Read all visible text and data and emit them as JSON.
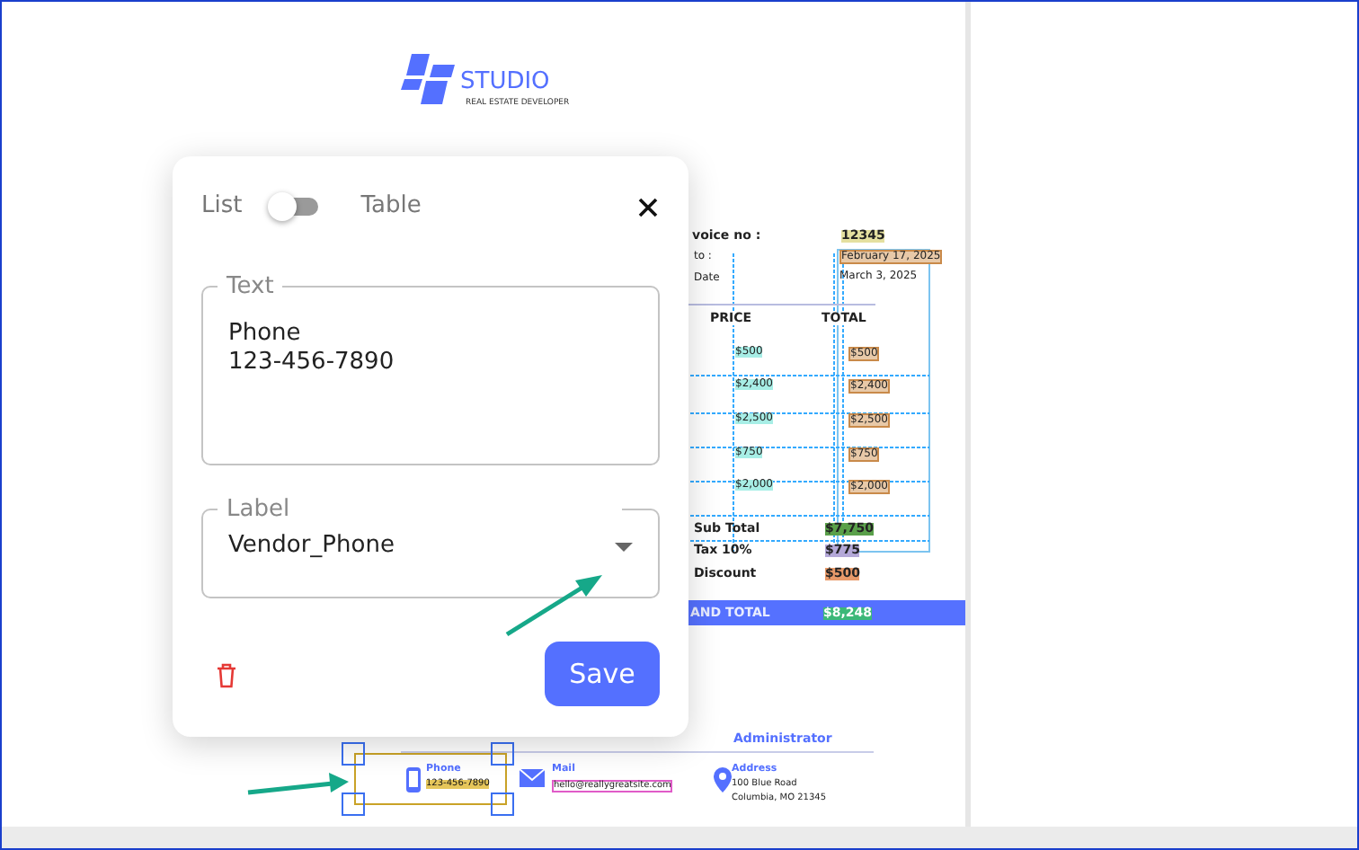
{
  "document": {
    "logo_title": "STUDIO",
    "logo_subtitle": "REAL ESTATE DEVELOPER",
    "invoice_label": "voice no :",
    "invoice_no": "12345",
    "to_label": "to :",
    "issue_date": "February 17, 2025",
    "date_label": "Date",
    "due_date": "March 3, 2025",
    "columns": [
      "PRICE",
      "TOTAL"
    ],
    "rows": [
      {
        "price": "$500",
        "total": "$500"
      },
      {
        "price": "$2,400",
        "total": "$2,400"
      },
      {
        "price": "$2,500",
        "total": "$2,500"
      },
      {
        "price": "$750",
        "total": "$750"
      },
      {
        "price": "$2,000",
        "total": "$2,000"
      }
    ],
    "summary": [
      {
        "label": "Sub Total",
        "value": "$7,750"
      },
      {
        "label": "Tax 10%",
        "value": "$775"
      },
      {
        "label": "Discount",
        "value": "$500"
      }
    ],
    "grand_total_label": "AND TOTAL",
    "grand_total": "$8,248",
    "footer": {
      "role": "Administrator",
      "contacts": [
        {
          "kind": "phone",
          "label": "Phone",
          "lines": [
            "123-456-7890"
          ],
          "selected": true
        },
        {
          "kind": "mail",
          "label": "Mail",
          "lines": [
            "hello@reallygreatsite.com"
          ],
          "selected": false
        },
        {
          "kind": "address",
          "label": "Address",
          "lines": [
            "100 Blue Road",
            "Columbia, MO 21345"
          ],
          "selected": false
        }
      ]
    }
  },
  "dialog": {
    "toggle": {
      "left": "List",
      "right": "Table",
      "on": false
    },
    "text_field": {
      "legend": "Text",
      "value": "Phone\n123-456-7890"
    },
    "label_field": {
      "legend": "Label",
      "value": "Vendor_Phone"
    },
    "save": "Save"
  }
}
